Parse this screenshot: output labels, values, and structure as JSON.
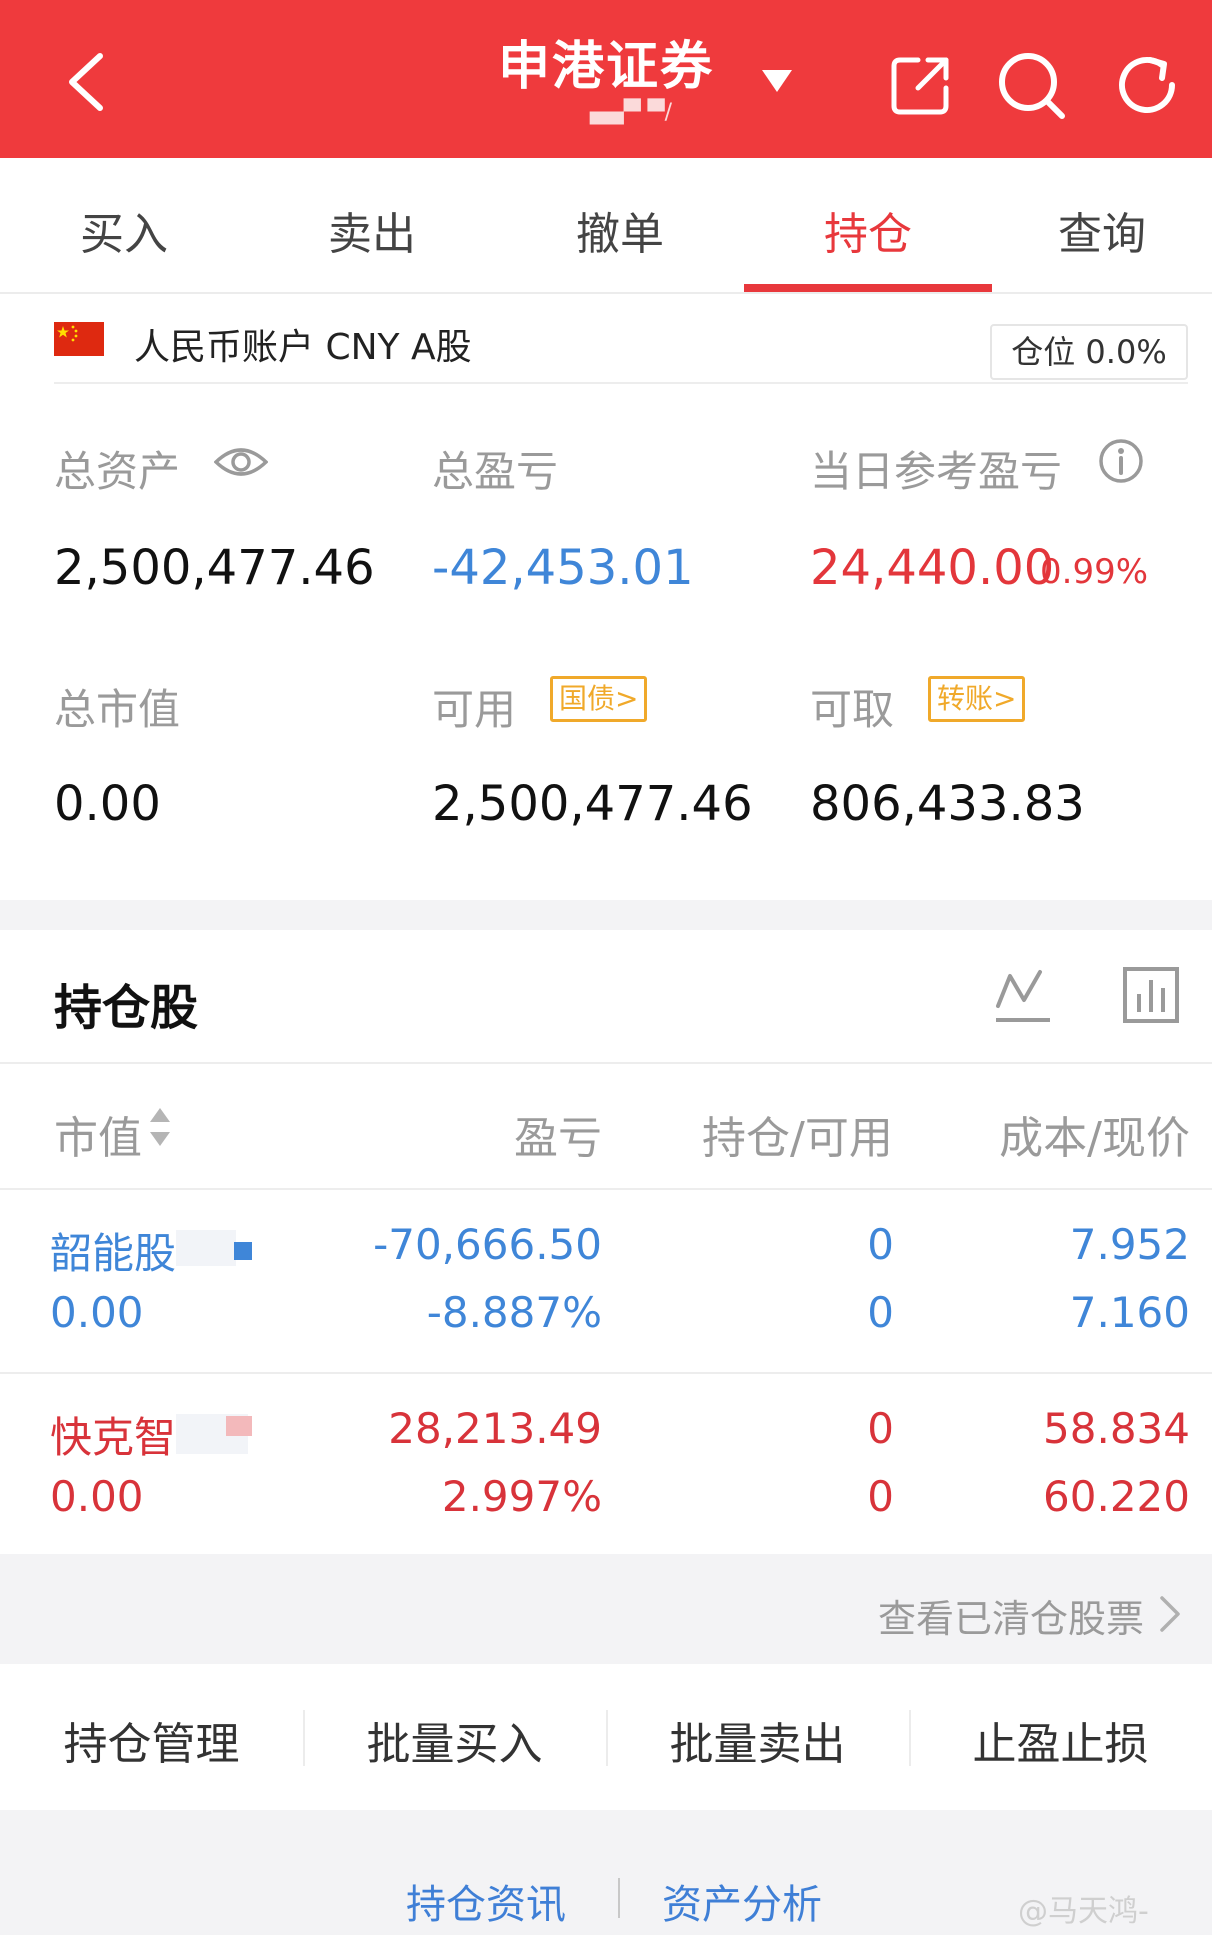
{
  "header": {
    "title": "申港证券",
    "account_masked": "▄▄▀ ▀/"
  },
  "tabs": [
    {
      "label": "买入"
    },
    {
      "label": "卖出"
    },
    {
      "label": "撤单"
    },
    {
      "label": "持仓"
    },
    {
      "label": "查询"
    }
  ],
  "active_tab": "持仓",
  "account": {
    "label": "人民币账户 CNY A股",
    "position_label": "仓位 0.0%"
  },
  "summary": {
    "total_assets_label": "总资产",
    "total_assets": "2,500,477.46",
    "total_pnl_label": "总盈亏",
    "total_pnl": "-42,453.01",
    "today_pnl_label": "当日参考盈亏",
    "today_pnl": "24,440.00",
    "today_pnl_pct": "0.99%",
    "market_value_label": "总市值",
    "market_value": "0.00",
    "available_label": "可用",
    "available_tag": "国债>",
    "available": "2,500,477.46",
    "withdrawable_label": "可取",
    "withdrawable_tag": "转账>",
    "withdrawable": "806,433.83"
  },
  "holdings": {
    "title": "持仓股",
    "columns": [
      "市值",
      "盈亏",
      "持仓/可用",
      "成本/现价"
    ],
    "rows": [
      {
        "name": "韶能股",
        "market_value": "0.00",
        "pnl": "-70,666.50",
        "pnl_pct": "-8.887%",
        "position": "0",
        "available": "0",
        "cost": "7.952",
        "price": "7.160"
      },
      {
        "name": "快克智",
        "market_value": "0.00",
        "pnl": "28,213.49",
        "pnl_pct": "2.997%",
        "position": "0",
        "available": "0",
        "cost": "58.834",
        "price": "60.220"
      }
    ]
  },
  "cleared_link": "查看已清仓股票",
  "actions": [
    {
      "label": "持仓管理"
    },
    {
      "label": "批量买入"
    },
    {
      "label": "批量卖出"
    },
    {
      "label": "止盈止损"
    }
  ],
  "bottom_links": [
    "持仓资讯",
    "资产分析"
  ],
  "watermark": "@马天鸿-",
  "colors": {
    "header_red": "#ef3a3d",
    "accent_red": "#e8383c",
    "profit_red": "#d8333a",
    "loss_blue": "#3f86d8",
    "tag_orange": "#f0a92a"
  }
}
